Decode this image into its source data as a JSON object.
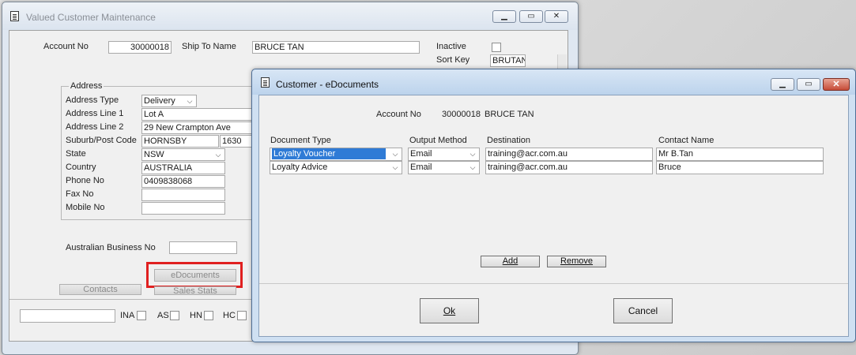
{
  "back_window": {
    "title": "Valued Customer Maintenance",
    "account_no_label": "Account No",
    "account_no_value": "30000018",
    "ship_to_label": "Ship To Name",
    "ship_to_value": "BRUCE TAN",
    "inactive_label": "Inactive",
    "sort_key_label": "Sort Key",
    "sort_key_value": "BRUTAN",
    "address_group": {
      "legend": "Address",
      "address_type_label": "Address Type",
      "address_type_value": "Delivery",
      "line1_label": "Address Line 1",
      "line1_value": "Lot A",
      "line2_label": "Address Line 2",
      "line2_value": "29 New Crampton Ave",
      "suburb_label": "Suburb/Post Code",
      "suburb_value": "HORNSBY",
      "postcode_value": "1630",
      "state_label": "State",
      "state_value": "NSW",
      "country_label": "Country",
      "country_value": "AUSTRALIA",
      "phone_label": "Phone No",
      "phone_value": "0409838068",
      "fax_label": "Fax No",
      "fax_value": "",
      "mobile_label": "Mobile No",
      "mobile_value": ""
    },
    "abn_label": "Australian Business No",
    "abn_value": "",
    "edocuments_button": "eDocuments",
    "contacts_button": "Contacts",
    "sales_stats_button": "Sales Stats",
    "bottom_field_value": "",
    "checks": [
      {
        "label": "INA"
      },
      {
        "label": "AS"
      },
      {
        "label": "HN"
      },
      {
        "label": "HC"
      }
    ]
  },
  "dialog": {
    "title": "Customer - eDocuments",
    "account_no_label": "Account No",
    "account_no_value": "30000018",
    "customer_name": "BRUCE TAN",
    "columns": {
      "document_type": "Document Type",
      "output_method": "Output Method",
      "destination": "Destination",
      "contact_name": "Contact Name"
    },
    "rows": [
      {
        "document_type": "Loyalty Voucher",
        "output_method": "Email",
        "destination": "training@acr.com.au",
        "contact_name": "Mr B.Tan"
      },
      {
        "document_type": "Loyalty Advice",
        "output_method": "Email",
        "destination": "training@acr.com.au",
        "contact_name": "Bruce"
      }
    ],
    "add_button": "Add",
    "remove_button": "Remove",
    "ok_button": "Ok",
    "cancel_button": "Cancel"
  },
  "icons": {
    "combo_arrow": "chevron-down-icon",
    "minimize": "minimize-icon",
    "maximize": "maximize-icon",
    "close": "close-icon",
    "window": "document-icon"
  },
  "colors": {
    "highlight": "#e02020",
    "selection": "#2f7bd6",
    "close_button": "#c64b37"
  }
}
